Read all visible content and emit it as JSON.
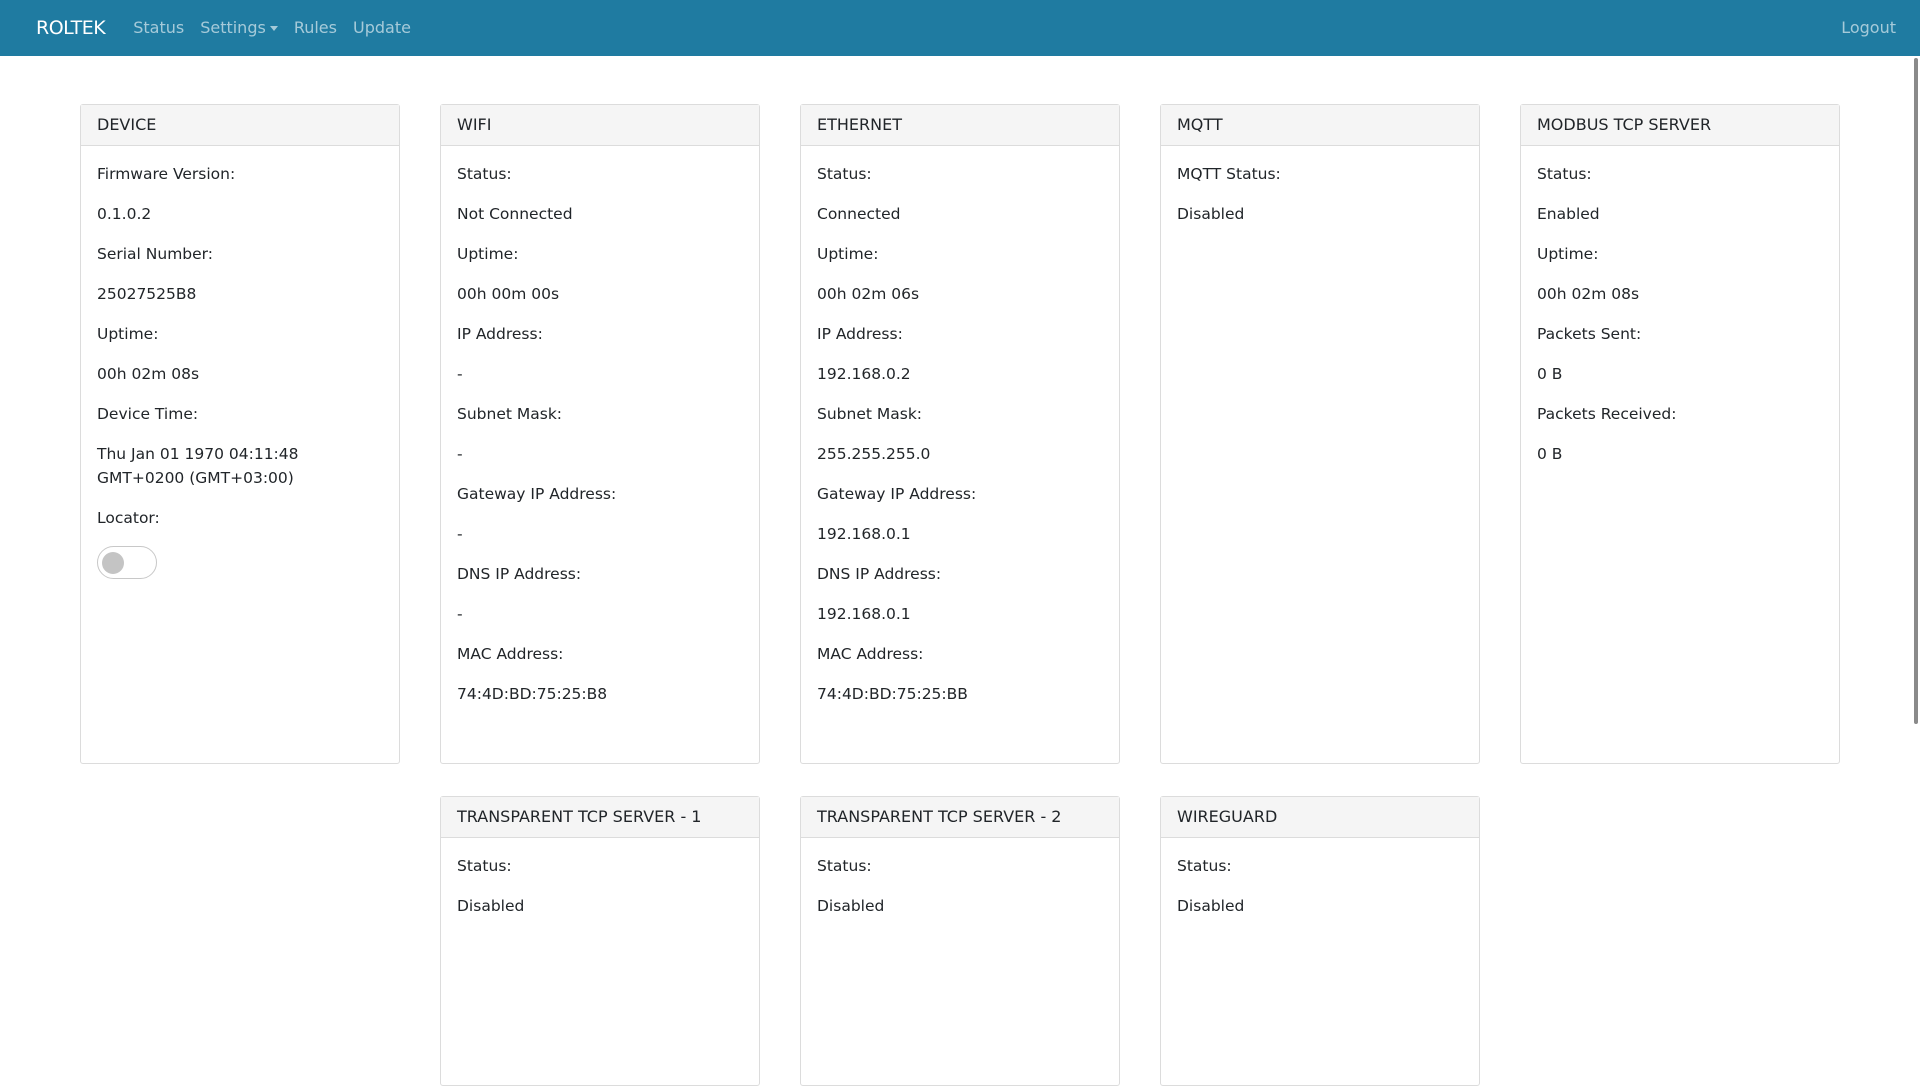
{
  "nav": {
    "brand": "ROLTEK",
    "items": [
      {
        "label": "Status"
      },
      {
        "label": "Settings"
      },
      {
        "label": "Rules"
      },
      {
        "label": "Update"
      }
    ],
    "logout": "Logout"
  },
  "device": {
    "title": "DEVICE",
    "firmware_label": "Firmware Version:",
    "firmware_value": "0.1.0.2",
    "serial_label": "Serial Number:",
    "serial_value": "25027525B8",
    "uptime_label": "Uptime:",
    "uptime_value": "00h 02m 08s",
    "time_label": "Device Time:",
    "time_value": "Thu Jan 01 1970 04:11:48 GMT+0200 (GMT+03:00)",
    "locator_label": "Locator:"
  },
  "wifi": {
    "title": "WIFI",
    "status_label": "Status:",
    "status_value": "Not Connected",
    "uptime_label": "Uptime:",
    "uptime_value": "00h 00m 00s",
    "ip_label": "IP Address:",
    "ip_value": "-",
    "subnet_label": "Subnet Mask:",
    "subnet_value": "-",
    "gateway_label": "Gateway IP Address:",
    "gateway_value": "-",
    "dns_label": "DNS IP Address:",
    "dns_value": "-",
    "mac_label": "MAC Address:",
    "mac_value": "74:4D:BD:75:25:B8"
  },
  "ethernet": {
    "title": "ETHERNET",
    "status_label": "Status:",
    "status_value": "Connected",
    "uptime_label": "Uptime:",
    "uptime_value": "00h 02m 06s",
    "ip_label": "IP Address:",
    "ip_value": "192.168.0.2",
    "subnet_label": "Subnet Mask:",
    "subnet_value": "255.255.255.0",
    "gateway_label": "Gateway IP Address:",
    "gateway_value": "192.168.0.1",
    "dns_label": "DNS IP Address:",
    "dns_value": "192.168.0.1",
    "mac_label": "MAC Address:",
    "mac_value": "74:4D:BD:75:25:BB"
  },
  "mqtt": {
    "title": "MQTT",
    "status_label": "MQTT Status:",
    "status_value": "Disabled"
  },
  "modbus": {
    "title": "MODBUS TCP SERVER",
    "status_label": "Status:",
    "status_value": "Enabled",
    "uptime_label": "Uptime:",
    "uptime_value": "00h 02m 08s",
    "sent_label": "Packets Sent:",
    "sent_value": "0 B",
    "received_label": "Packets Received:",
    "received_value": "0 B"
  },
  "tcp1": {
    "title": "TRANSPARENT TCP SERVER - 1",
    "status_label": "Status:",
    "status_value": "Disabled"
  },
  "tcp2": {
    "title": "TRANSPARENT TCP SERVER - 2",
    "status_label": "Status:",
    "status_value": "Disabled"
  },
  "wireguard": {
    "title": "WIREGUARD",
    "status_label": "Status:",
    "status_value": "Disabled"
  },
  "colors": {
    "navbar": "#1f7ba1",
    "card_header": "#f5f5f5",
    "border": "#dcdcdc"
  }
}
